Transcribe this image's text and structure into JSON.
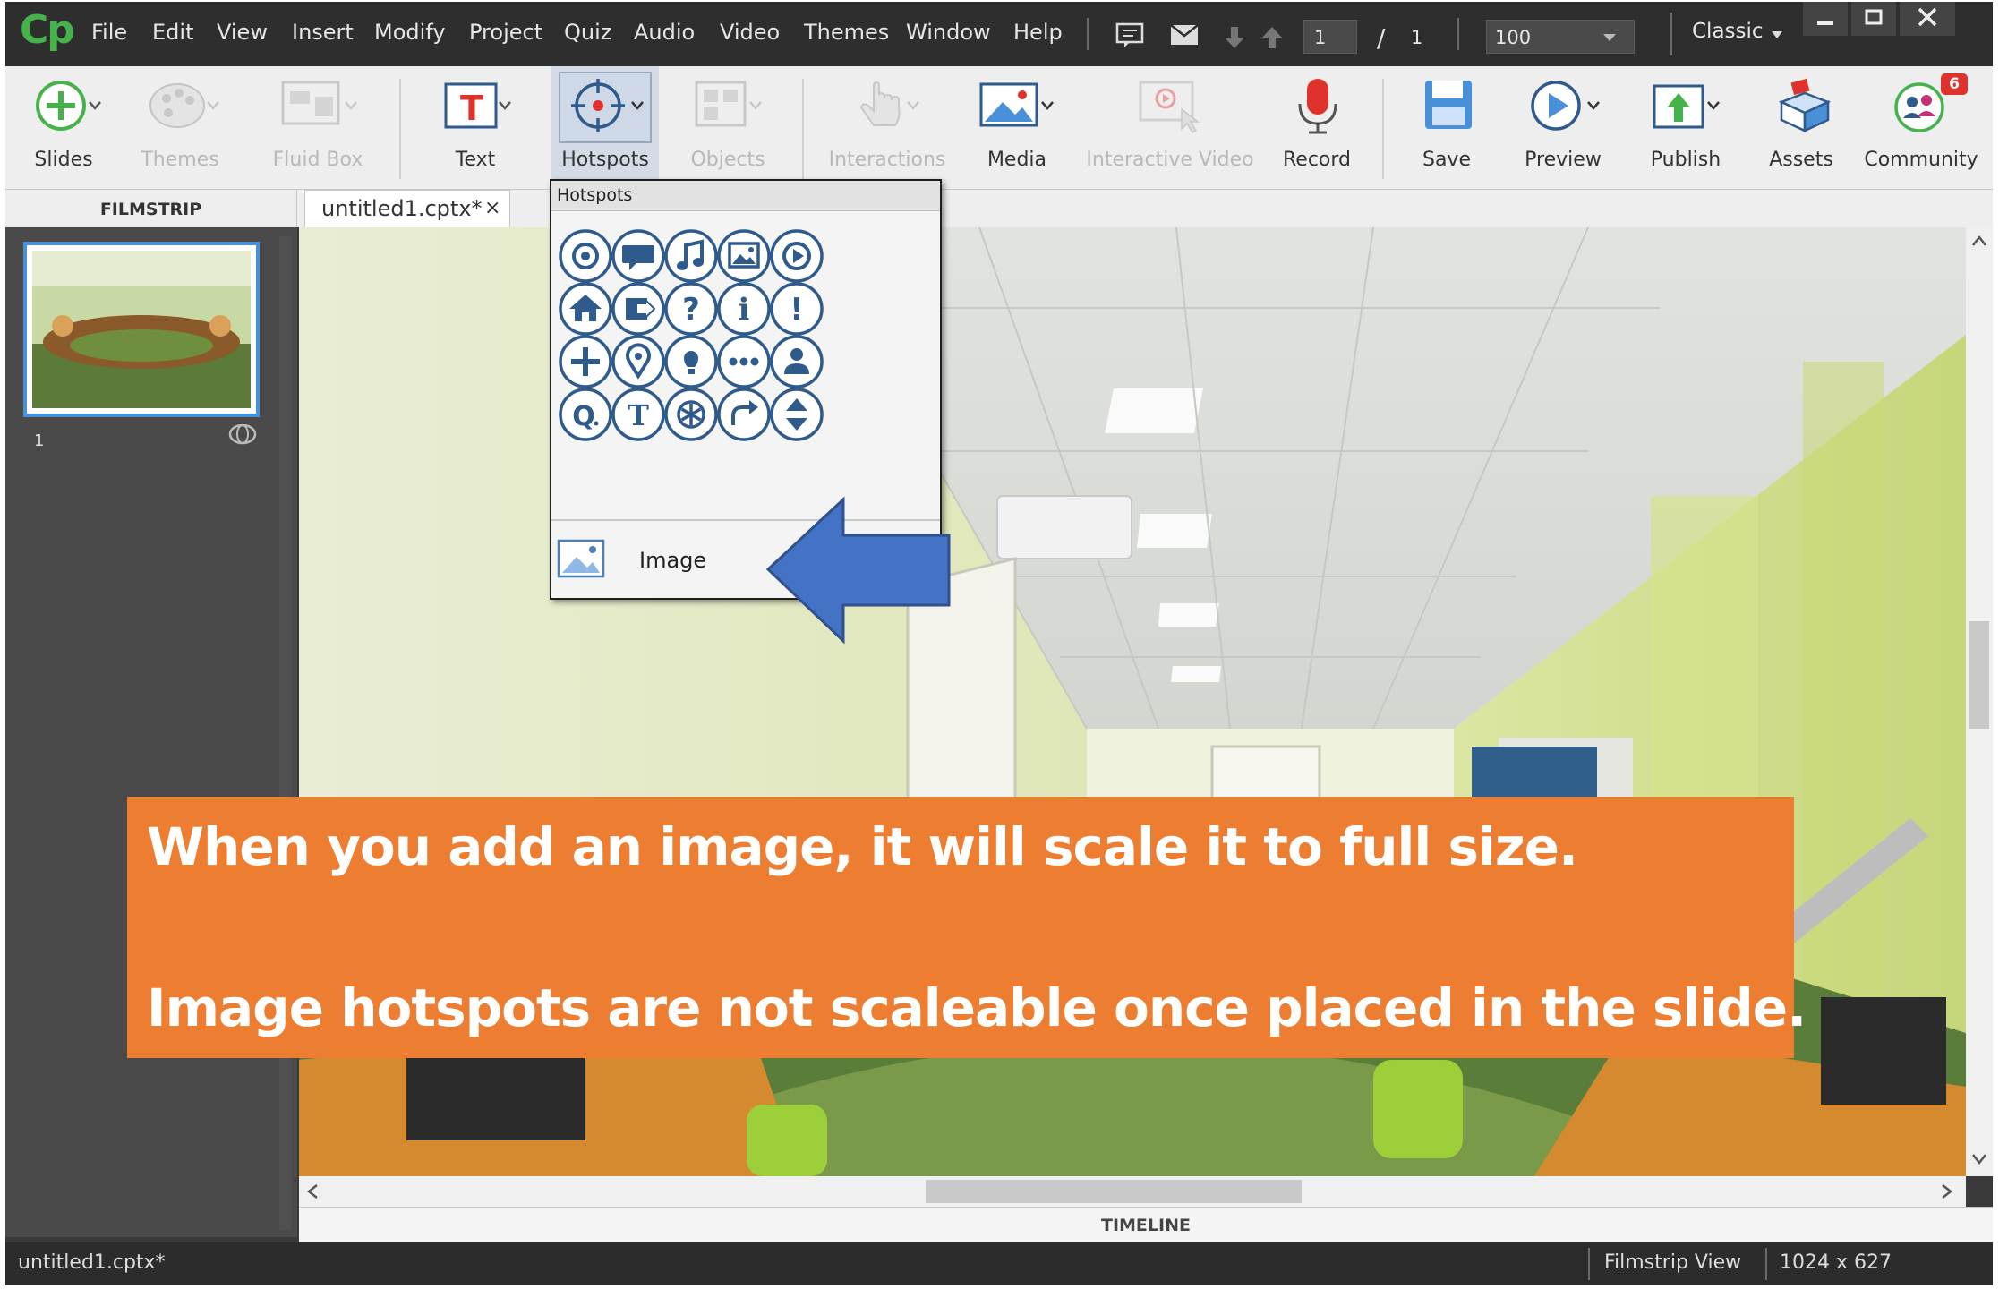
{
  "app": {
    "logo": "Cp"
  },
  "menu": [
    "File",
    "Edit",
    "View",
    "Insert",
    "Modify",
    "Project",
    "Quiz",
    "Audio",
    "Video",
    "Themes",
    "Window",
    "Help"
  ],
  "nav": {
    "current_slide": "1",
    "separator": "/",
    "total_slides": "1",
    "zoom": "100",
    "workspace": "Classic"
  },
  "toolbar": {
    "slides": "Slides",
    "themes": "Themes",
    "fluid_box": "Fluid Box",
    "text": "Text",
    "hotspots": "Hotspots",
    "objects": "Objects",
    "interactions": "Interactions",
    "media": "Media",
    "interactive_video": "Interactive Video",
    "record": "Record",
    "save": "Save",
    "preview": "Preview",
    "publish": "Publish",
    "assets": "Assets",
    "community": "Community",
    "community_badge": "6"
  },
  "filmstrip": {
    "header": "FILMSTRIP",
    "slide_number": "1"
  },
  "document": {
    "tab_title": "untitled1.cptx*",
    "close": "×"
  },
  "hotspots_menu": {
    "title": "Hotspots",
    "icons": [
      "target",
      "chat-bubble",
      "music-note",
      "picture",
      "play",
      "home",
      "exit",
      "question",
      "info",
      "exclamation",
      "plus",
      "location-pin",
      "lightbulb",
      "ellipsis",
      "person",
      "q-letter",
      "t-letter",
      "asterisk",
      "redo-arrow",
      "up-down"
    ],
    "image_item": "Image"
  },
  "callout": {
    "line1": "When you add an image, it will scale it to full size.",
    "line2": "Image hotspots  are not scaleable once placed in the slide."
  },
  "timeline": {
    "label": "TIMELINE"
  },
  "status": {
    "filename": "untitled1.cptx*",
    "view": "Filmstrip View",
    "dimensions": "1024 x 627"
  },
  "colors": {
    "callout": "#ed7d31",
    "arrow": "#4472c4",
    "hotspot_icon": "#2e5a8c"
  }
}
